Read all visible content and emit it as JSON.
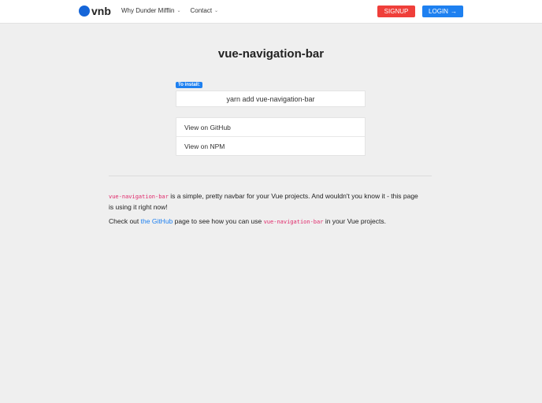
{
  "navbar": {
    "brand": "vnb",
    "links": [
      {
        "label": "Why Dunder Mifflin",
        "chevron": "⌄"
      },
      {
        "label": "Contact",
        "chevron": "⌄"
      }
    ],
    "signup_label": "SIGNUP",
    "login_label": "LOGIN",
    "login_arrow": "→",
    "colors": {
      "brand": "#1565d8",
      "signup": "#ef3f3a",
      "login": "#1e80f0"
    }
  },
  "main": {
    "title": "vue-navigation-bar",
    "install_tag": "To install:",
    "install_command": "yarn add vue-navigation-bar",
    "links": [
      {
        "label": "View on GitHub"
      },
      {
        "label": "View on NPM"
      }
    ],
    "p1": {
      "code": "vue-navigation-bar",
      "text": " is a simple, pretty navbar for your Vue projects. And wouldn't you know it - this page is using it right now!"
    },
    "p2": {
      "prefix": "Check out ",
      "link": "the GitHub",
      "middle": " page to see how you can use ",
      "code": "vue-navigation-bar",
      "suffix": " in your Vue projects."
    }
  }
}
